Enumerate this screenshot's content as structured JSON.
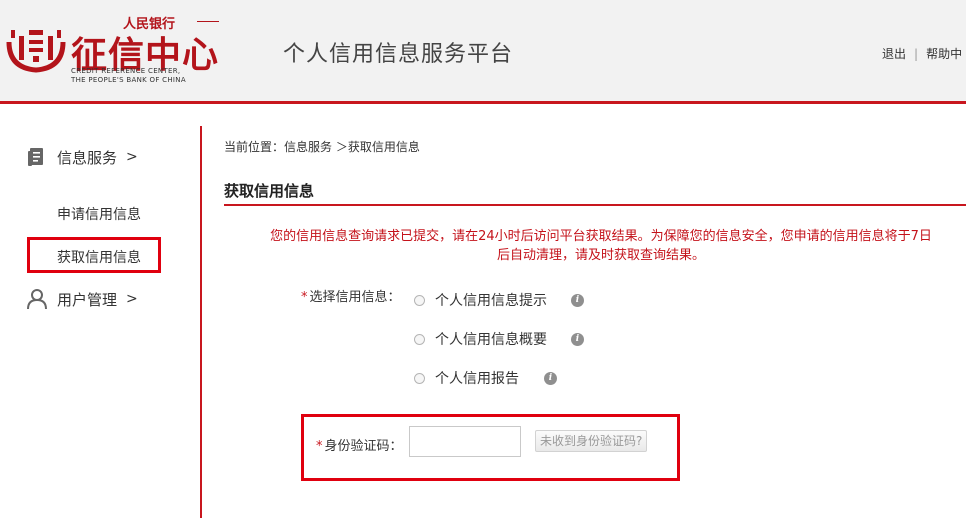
{
  "header": {
    "logo_top_text": "人民银行",
    "logo_main_text": "征信中心",
    "logo_en_line1": "CREDIT REFERENCE CENTER,",
    "logo_en_line2": "THE PEOPLE'S BANK OF CHINA",
    "platform_title": "个人信用信息服务平台",
    "logout_label": "退出",
    "help_label": "帮助中"
  },
  "sidebar": {
    "groups": [
      {
        "label": "信息服务",
        "arrow": ">",
        "icon": "document-icon",
        "items": [
          {
            "label": "申请信用信息"
          },
          {
            "label": "获取信用信息",
            "active": true
          }
        ]
      },
      {
        "label": "用户管理",
        "arrow": ">",
        "icon": "user-icon"
      }
    ]
  },
  "main": {
    "breadcrumb": "当前位置：信息服务 ＞获取信用信息",
    "section_title": "获取信用信息",
    "notice_line1": "您的信用信息查询请求已提交，请在24小时后访问平台获取结果。为保障您的信息安全，您申请的信用信息将于7日",
    "notice_line2": "后自动清理，请及时获取查询结果。",
    "select_label": "选择信用信息：",
    "options": [
      {
        "label": "个人信用信息提示",
        "selected": false
      },
      {
        "label": "个人信用信息概要",
        "selected": false
      },
      {
        "label": "个人信用报告",
        "selected": false
      }
    ],
    "code_label": "身份验证码：",
    "code_value": "",
    "code_button": "未收到身份验证码?",
    "required_mark": "*"
  },
  "colors": {
    "accent": "#c8161e",
    "highlight_box": "#e0000f",
    "notice": "#c4121a"
  }
}
